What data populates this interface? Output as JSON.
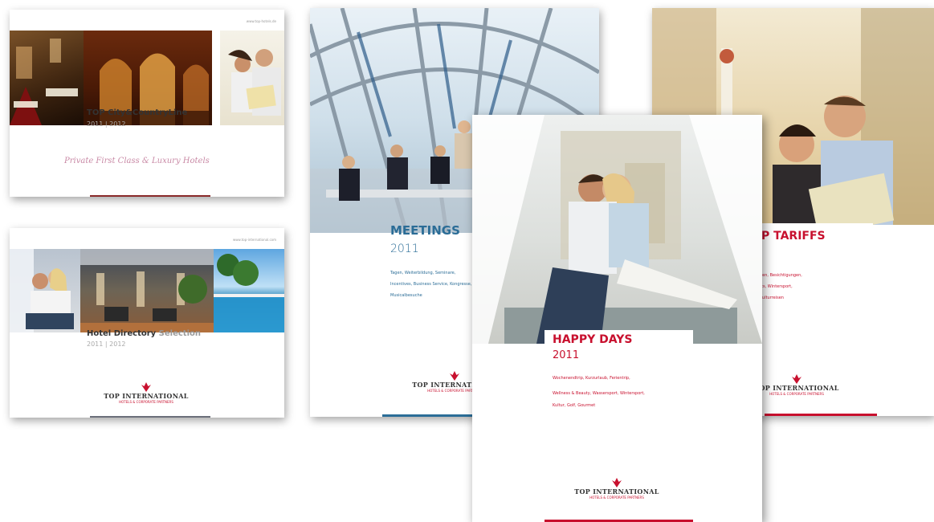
{
  "colors": {
    "brand_red": "#c8102e",
    "meetings_blue": "#2b6d97",
    "text_gray": "#777777"
  },
  "logo": {
    "name": "TOP INTERNATIONAL",
    "tagline": "HOTELS & CORPORATE PARTNERS"
  },
  "brochures": {
    "city_country": {
      "url": "www.top-hotels.de",
      "title": "TOP City&CountryLine",
      "year": "2011 | 2012",
      "slogan": "Private First Class & Luxury Hotels"
    },
    "directory": {
      "url": "www.top-international.com",
      "title_bold": "Hotel Directory",
      "title_light": "Selection",
      "year": "2011 | 2012"
    },
    "meetings": {
      "title": "MEETINGS",
      "year": "2011",
      "lines": [
        "Tagen, Weiterbildung, Seminare,",
        "Incentives, Business Service, Kongresse,",
        "Musicalbesuche"
      ]
    },
    "happy_days": {
      "title": "HAPPY DAYS",
      "year": "2011",
      "lines": [
        "Wochenendtrip, Kurzurlaub, Ferientrip,",
        "Wellness & Beauty, Wassersport, Wintersport,",
        "Kultur, Golf, Gourmet"
      ]
    },
    "tariffs": {
      "title": "P TARIFFS",
      "lines": [
        "nen, Besichtigungen,",
        "rts, Wintersport,",
        "Kulturreisen"
      ]
    }
  }
}
